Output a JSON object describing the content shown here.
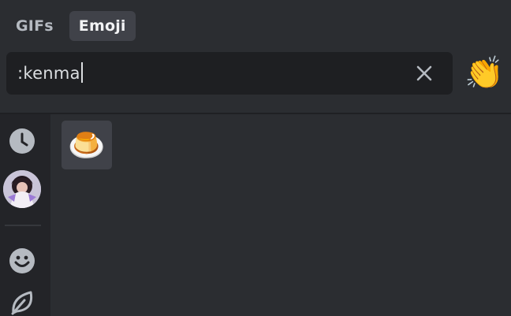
{
  "tabs": [
    {
      "label": "GIFs",
      "active": false
    },
    {
      "label": "Emoji",
      "active": true
    }
  ],
  "search": {
    "value": ":kenma",
    "clear_icon": "close-icon"
  },
  "preview_emoji": "👏",
  "sidebar": {
    "items": [
      {
        "name": "recent",
        "icon": "clock-icon"
      },
      {
        "name": "server",
        "icon": "avatar"
      },
      {
        "name": "people",
        "icon": "smiley-icon"
      },
      {
        "name": "nature",
        "icon": "leaf-icon"
      }
    ]
  },
  "results": [
    {
      "emoji": "🍮",
      "name": "custard"
    }
  ],
  "colors": {
    "background": "#2b2d31",
    "sidebar": "#232428",
    "input": "#1e1f22",
    "active_tab": "#404249",
    "text": "#dbdee1",
    "muted": "#b5bac1"
  }
}
